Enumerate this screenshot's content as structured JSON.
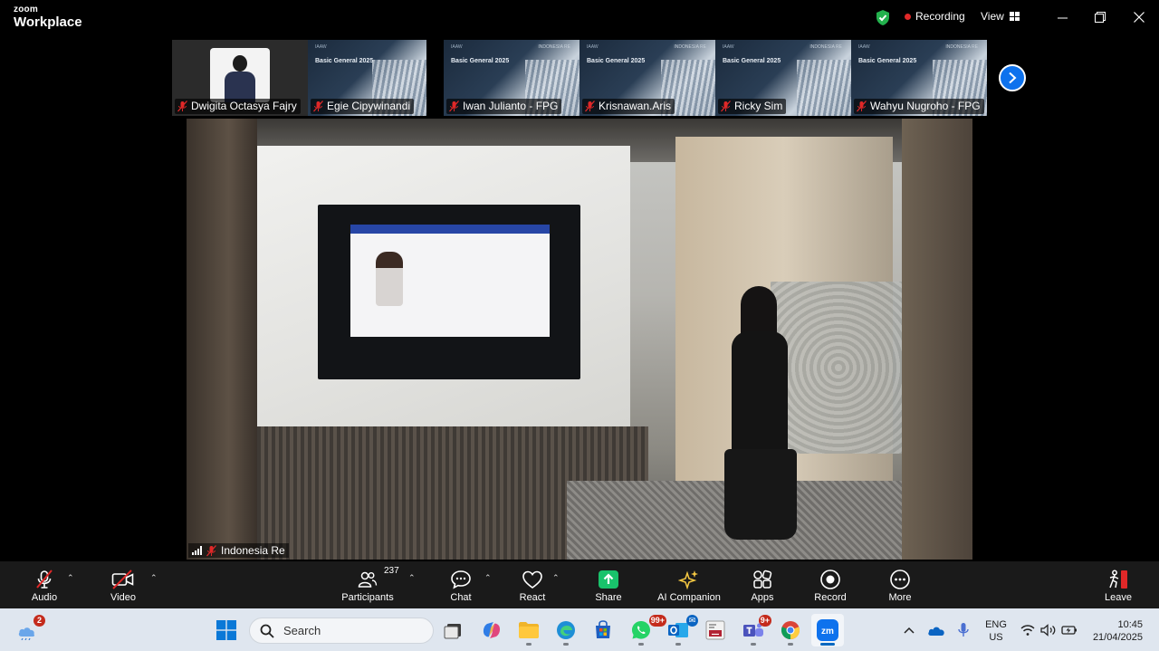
{
  "app": {
    "brand_top": "zoom",
    "brand_bottom": "Workplace"
  },
  "header": {
    "recording_label": "Recording",
    "view_label": "View"
  },
  "thumbnails": {
    "slide_header": "IAAW",
    "slide_title": "Basic General 2025",
    "slide_logo": "INDONESIA RE",
    "items": [
      {
        "name": "Dwigita Octasya Fajry",
        "kind": "person"
      },
      {
        "name": "Egie Cipywinandi",
        "kind": "slide"
      },
      {
        "name": "Iwan Julianto - FPG",
        "kind": "slide"
      },
      {
        "name": "Krisnawan.Aris",
        "kind": "slide"
      },
      {
        "name": "Ricky Sim",
        "kind": "slide"
      },
      {
        "name": "Wahyu Nugroho - FPG",
        "kind": "slide"
      }
    ]
  },
  "main_video": {
    "participant_name": "Indonesia Re"
  },
  "toolbar": {
    "audio": "Audio",
    "video": "Video",
    "participants": "Participants",
    "participants_count": "237",
    "chat": "Chat",
    "react": "React",
    "share": "Share",
    "ai_companion": "AI Companion",
    "apps": "Apps",
    "record": "Record",
    "more": "More",
    "leave": "Leave"
  },
  "taskbar": {
    "widgets_badge": "2",
    "search_placeholder": "Search",
    "whatsapp_badge": "99+",
    "teams_badge": "9+",
    "language_line1": "ENG",
    "language_line2": "US",
    "time": "10:45",
    "date": "21/04/2025"
  },
  "colors": {
    "accent": "#0e72ed",
    "share_green": "#19c26b",
    "record_red": "#e02828",
    "muted_red": "#e02828"
  }
}
